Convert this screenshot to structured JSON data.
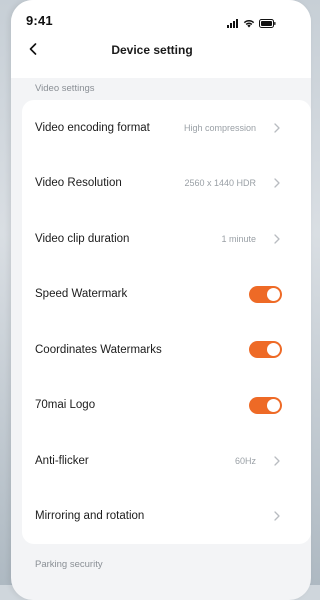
{
  "status_bar": {
    "time": "9:41",
    "icons": [
      "signal-icon",
      "wifi-icon",
      "battery-icon"
    ]
  },
  "nav": {
    "title": "Device setting",
    "back_icon": "chevron-left-icon"
  },
  "sections": {
    "video_header": "Video settings",
    "parking_header": "Parking security"
  },
  "settings": [
    {
      "label": "Video encoding format",
      "value": "High compression",
      "type": "link"
    },
    {
      "label": "Video Resolution",
      "value": "2560 x 1440 HDR",
      "type": "link"
    },
    {
      "label": "Video clip duration",
      "value": "1 minute",
      "type": "link"
    },
    {
      "label": "Speed Watermark",
      "type": "toggle",
      "on": true
    },
    {
      "label": "Coordinates Watermarks",
      "type": "toggle",
      "on": true
    },
    {
      "label": "70mai Logo",
      "type": "toggle",
      "on": true
    },
    {
      "label": "Anti-flicker",
      "value": "60Hz",
      "type": "link"
    },
    {
      "label": "Mirroring and rotation",
      "value": "",
      "type": "link"
    }
  ],
  "colors": {
    "accent": "#ee6a26",
    "background": "#f3f4f6",
    "card": "#ffffff",
    "secondary_text": "#9aa0a6"
  }
}
